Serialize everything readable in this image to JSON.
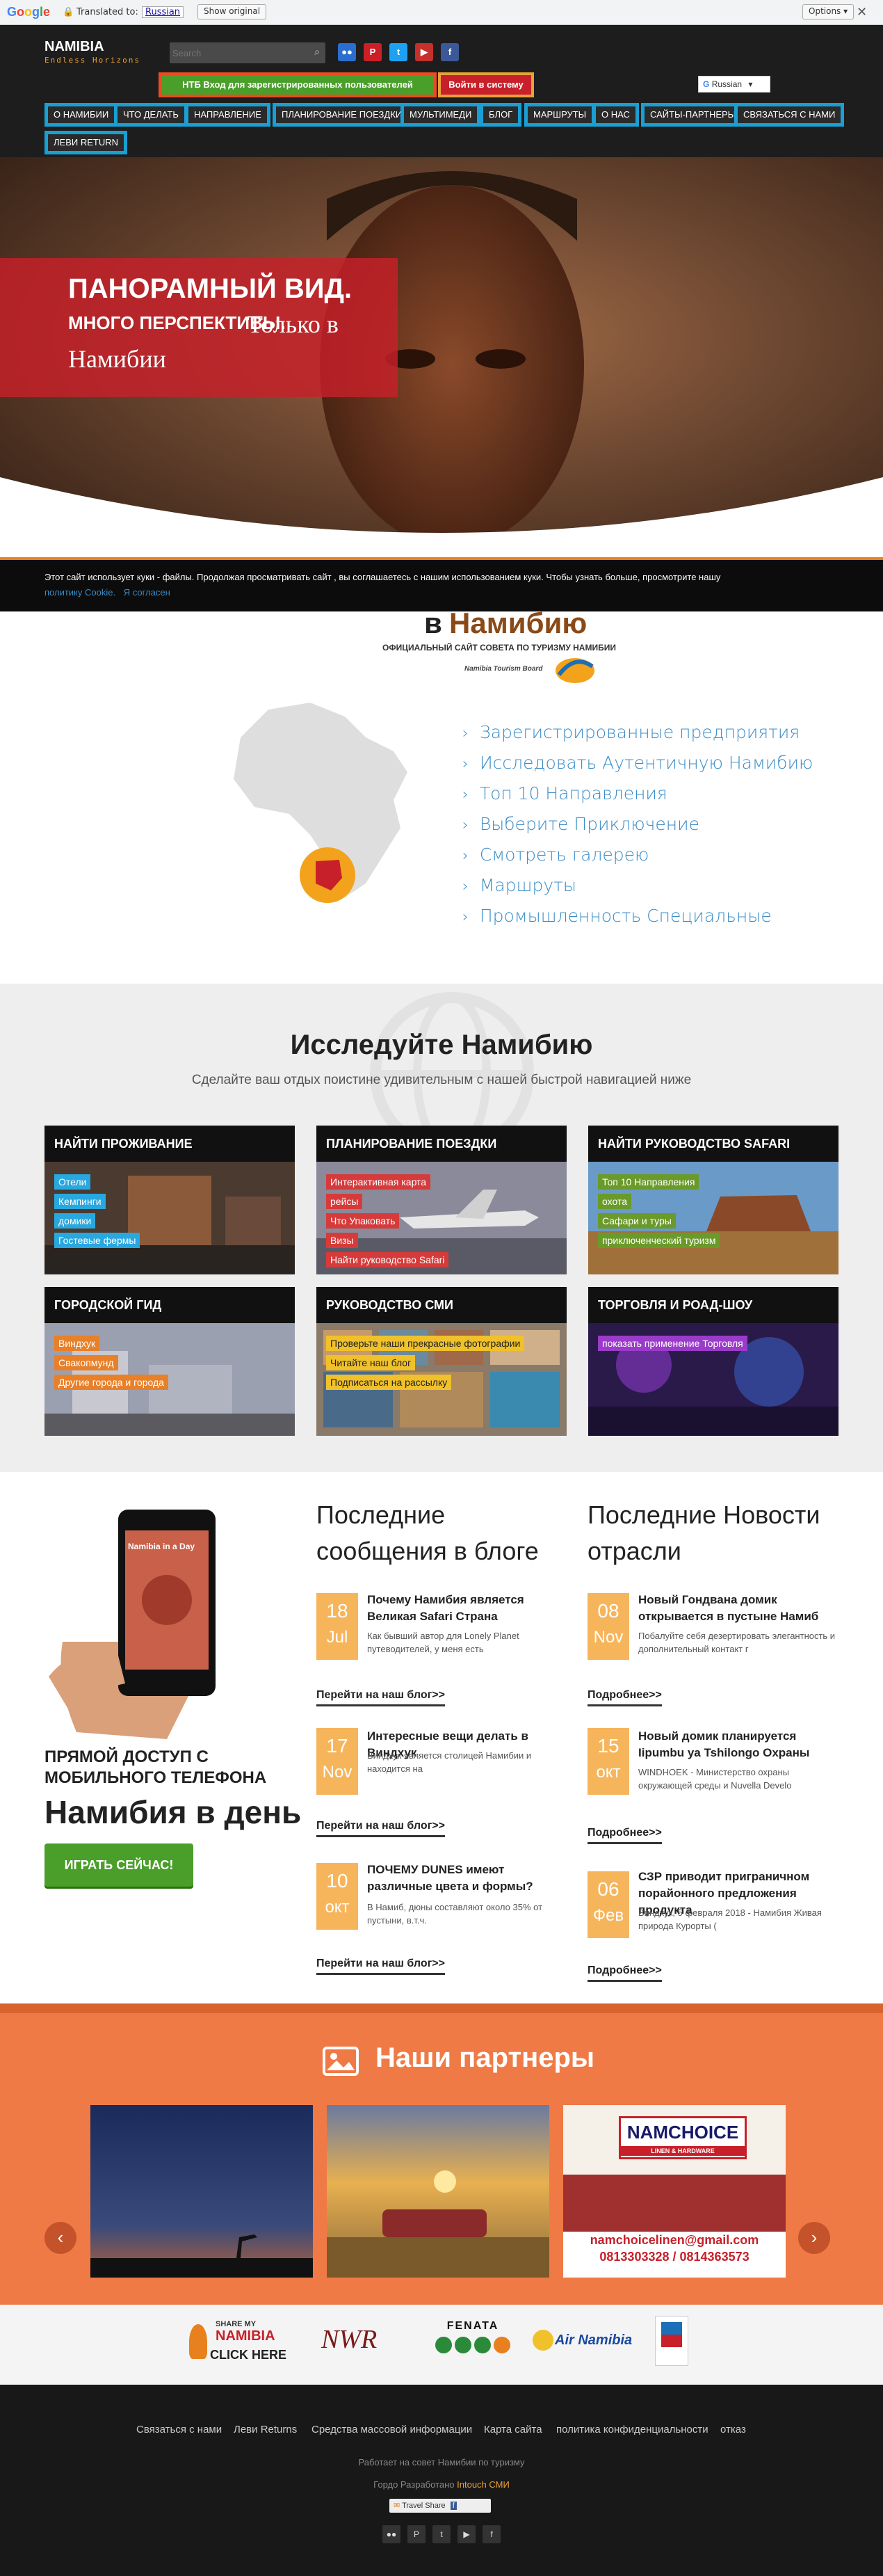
{
  "translate_bar": {
    "logo": "Google",
    "translated_to": "Translated to:",
    "language": "Russian",
    "show_original": "Show original",
    "options": "Options ▾"
  },
  "site": {
    "name": "NAMIBIA",
    "tagline": "Endless Horizons"
  },
  "search": {
    "placeholder": "Search"
  },
  "social_icons": [
    "flickr-icon",
    "pinterest-icon",
    "twitter-icon",
    "youtube-icon",
    "facebook-icon"
  ],
  "buttons": {
    "register": "НТБ Вход для зарегистрированных пользователей",
    "login": "Войти в систему"
  },
  "lang_select": "Russian",
  "nav": [
    "О НАМИБИИ",
    "ЧТО ДЕЛАТЬ",
    "НАПРАВЛЕНИЕ",
    "ПЛАНИРОВАНИЕ ПОЕЗДКИ",
    "МУЛЬТИМЕДИ",
    "БЛОГ",
    "МАРШРУТЫ",
    "О НАС",
    "САЙТЫ-ПАРТНЕРЫ",
    "СВЯЗАТЬСЯ С НАМИ",
    "ЛЕВИ RETURN"
  ],
  "hero": {
    "line1": "ПАНОРАМНЫЙ ВИД.",
    "line2a": "МНОГО ПЕРСПЕКТИВЫ.",
    "line2b": "Только в",
    "line3": "Намибии"
  },
  "cookie": {
    "text": "Этот сайт использует куки - файлы. Продолжая просматривать сайт , вы соглашаетесь с нашим использованием куки. Чтобы узнать больше, просмотрите нашу",
    "policy": "политику Cookie.",
    "agree": "Я согласен"
  },
  "brand": {
    "title_prefix": "в",
    "title": "Намибию",
    "subtitle": "ОФИЦИАЛЬНЫЙ САЙТ СОВЕТА ПО ТУРИЗМУ НАМИБИИ",
    "board": "Namibia Tourism Board"
  },
  "quick_links": [
    "Зарегистрированные предприятия",
    "Исследовать Аутентичную Намибию",
    "Топ 10 Направления",
    "Выберите Приключение",
    "Смотреть галерею",
    "Маршруты",
    "Промышленность Специальные"
  ],
  "explore": {
    "title": "Исследуйте Намибию",
    "subtitle": "Сделайте ваш отдых поистине удивительным с нашей быстрой навигацией ниже"
  },
  "cards": [
    {
      "title": "НАЙТИ ПРОЖИВАНИЕ",
      "tags": [
        "Отели",
        "Кемпинги",
        "домики",
        "Гостевые фермы"
      ],
      "tag_color": "#29a7df"
    },
    {
      "title": "ПЛАНИРОВАНИЕ ПОЕЗДКИ",
      "tags": [
        "Интерактивная карта",
        "рейсы",
        "Что Упаковать",
        "Визы",
        "Найти руководство Safari"
      ],
      "tag_color": "#d63b3b"
    },
    {
      "title": "НАЙТИ РУКОВОДСТВО SAFARI",
      "tags": [
        "Топ 10 Направления",
        "охота",
        "Сафари и туры",
        "приключенческий туризм"
      ],
      "tag_color": "#6a9a2a"
    },
    {
      "title": "ГОРОДСКОЙ ГИД",
      "tags": [
        "Виндхук",
        "Свакопмунд",
        "Другие города и города"
      ],
      "tag_color": "#e8802a"
    },
    {
      "title": "РУКОВОДСТВО СМИ",
      "tags": [
        "Проверьте наши прекрасные фотографии",
        "Читайте наш блог",
        "Подписаться на рассылку"
      ],
      "tag_color": "#f0c12a"
    },
    {
      "title": "ТОРГОВЛЯ И РОАД-ШОУ",
      "tags": [
        "показать применение Торговля"
      ],
      "tag_color": "#9a3bc9"
    }
  ],
  "app": {
    "line1": "ПРЯМОЙ ДОСТУП С",
    "line2": "МОБИЛЬНОГО ТЕЛЕФОНА",
    "line3": "Намибия в день",
    "button": "ИГРАТЬ СЕЙЧАС!",
    "phone_title": "Namibia in a Day"
  },
  "blog": {
    "title": "Последние сообщения в блоге",
    "posts": [
      {
        "day": "18",
        "month": "Jul",
        "title": "Почему Намибия является Великая Safari Страна",
        "desc": "Как бывший автор для Lonely Planet путеводителей, у меня есть",
        "link": "Перейти на наш блог>>"
      },
      {
        "day": "17",
        "month": "Nov",
        "title": "Интересные вещи делать в Виндхук",
        "desc": "Виндхук является столицей Намибии и находится на",
        "link": "Перейти на наш блог>>"
      },
      {
        "day": "10",
        "month": "окт",
        "title": "ПОЧЕМУ DUNES имеют различные цвета и формы?",
        "desc": "В Намиб, дюны составляют около 35% от пустыни, в.т.ч.",
        "link": "Перейти на наш блог>>"
      }
    ]
  },
  "news": {
    "title": "Последние Новости отрасли",
    "posts": [
      {
        "day": "08",
        "month": "Nov",
        "title": "Новый Гондвана домик открывается в пустыне Намиб",
        "desc": "Побалуйте себя дезертировать элегантность и дополнительный контакт г",
        "link": "Подробнее>>"
      },
      {
        "day": "15",
        "month": "окт",
        "title": "Новый домик планируется Iipumbu ya Tshilongo Охраны",
        "desc": "WINDHOEK - Министерство охраны окружающей среды и Nuvella Develo",
        "link": "Подробнее>>"
      },
      {
        "day": "06",
        "month": "Фев",
        "title": "СЗР приводит приграничном порайонного предложения продукта",
        "desc": "Виндхук, 5 февраля 2018 - Намибия Живая природа Курорты (",
        "link": "Подробнее>>"
      }
    ]
  },
  "partners": {
    "title": "Наши партнеры",
    "namchoice": "NAMCHOICE",
    "namchoice_sub": "LINEN & HARDWARE",
    "email": "namchoicelinen@gmail.com",
    "phone": "0813303328 / 0814363573"
  },
  "partner_logos": {
    "share1": "SHARE MY",
    "share2": "NAMIBIA",
    "share3": "CLICK HERE",
    "nwr": "NWR",
    "fenata": "FENATA",
    "airnamibia": "Air Namibia"
  },
  "footer": {
    "links": [
      "Связаться с нами",
      "Леви Returns",
      "Средства массовой информации",
      "Карта сайта",
      "политика конфиденциальности",
      "отказ"
    ],
    "powered": "Работает на совет Намибии по туризму",
    "dev_prefix": "Гордо Разработано",
    "dev": "Intouch СМИ",
    "travelshare": "Travel Share",
    "icons": [
      "flickr-icon",
      "pinterest-icon",
      "twitter-icon",
      "youtube-icon",
      "facebook-icon"
    ]
  },
  "colors": {
    "accent_blue": "#1a9fd3",
    "orange": "#ef7a45",
    "red": "#c8202a",
    "green": "#4a9e2a"
  }
}
